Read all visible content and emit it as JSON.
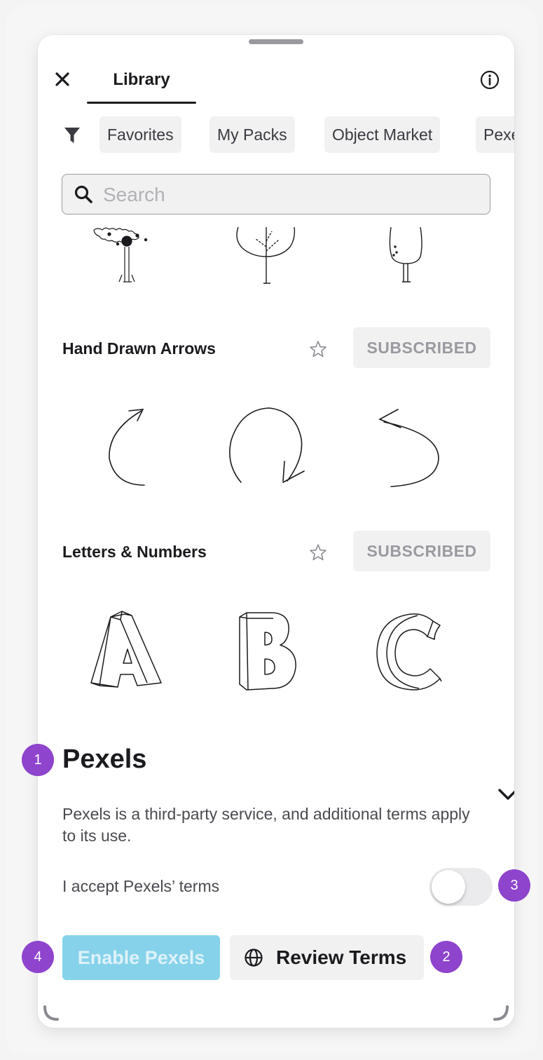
{
  "header": {
    "tab_label": "Library"
  },
  "filters": {
    "chips": [
      "Favorites",
      "My Packs",
      "Object Market",
      "Pexels"
    ]
  },
  "search": {
    "placeholder": "Search"
  },
  "packs": [
    {
      "title": "Hand Drawn Arrows",
      "status_button": "SUBSCRIBED"
    },
    {
      "title": "Letters & Numbers",
      "status_button": "SUBSCRIBED"
    }
  ],
  "pexels": {
    "title": "Pexels",
    "description": "Pexels is a third-party service, and additional terms apply to its use.",
    "accept_label": "I accept Pexels’ terms",
    "toggle_on": false,
    "enable_button": "Enable Pexels",
    "review_button": "Review Terms"
  },
  "annotations": [
    "1",
    "2",
    "3",
    "4"
  ],
  "colors": {
    "badge": "#8e44cc",
    "enable_button_bg": "#86d2ea",
    "chip_bg": "#f1f1f2"
  }
}
